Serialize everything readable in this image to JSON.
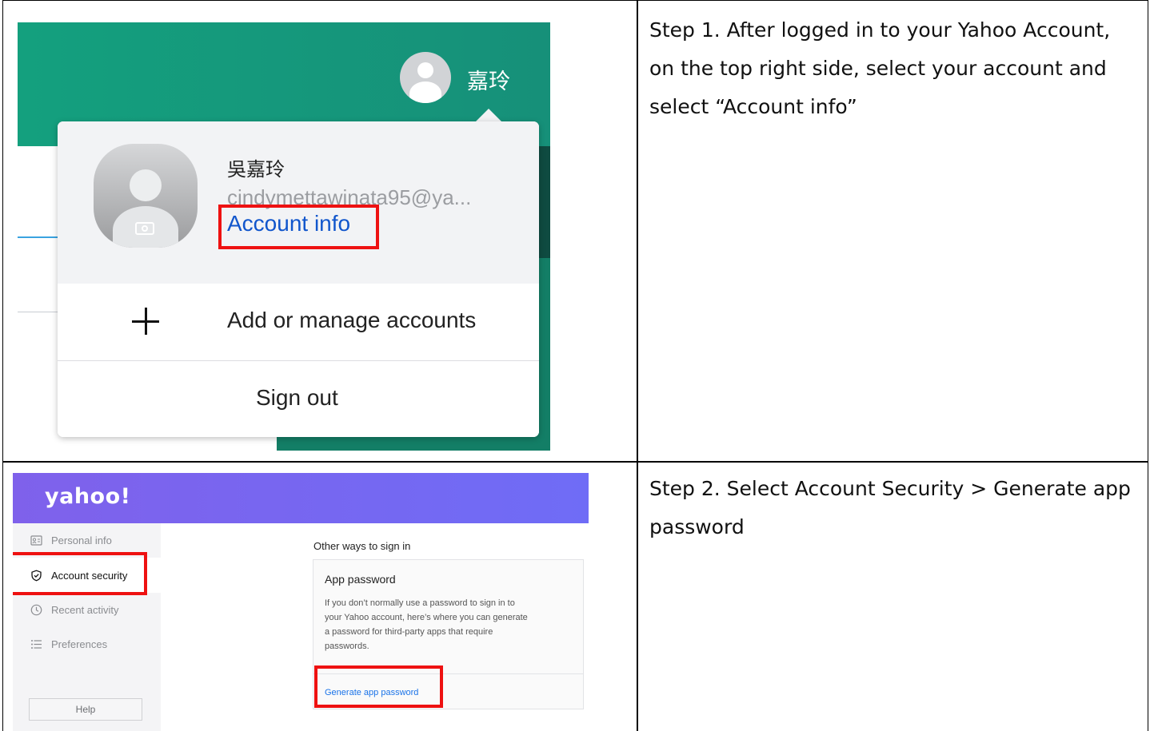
{
  "steps": {
    "step1_text": "Step 1. After logged in to your Yahoo Account, on the top right side, select your account and select “Account info”",
    "step2_text": "Step 2. Select Account Security > Generate app password"
  },
  "screenshot1": {
    "header_name": "嘉玲",
    "menu": {
      "full_name": "吳嘉玲",
      "email": "cindymettawinata95@ya...",
      "account_info_link": "Account info",
      "add_manage_label": "Add or manage accounts",
      "sign_out_label": "Sign out"
    },
    "colors": {
      "header_teal": "#14a07e",
      "highlight_red": "#ee1111",
      "link_blue": "#1156cc"
    }
  },
  "screenshot2": {
    "logo": "yahoo!",
    "sidebar": {
      "items": [
        {
          "label": "Personal info",
          "icon": "id-card-icon"
        },
        {
          "label": "Account security",
          "icon": "shield-icon",
          "selected": true
        },
        {
          "label": "Recent activity",
          "icon": "clock-icon"
        },
        {
          "label": "Preferences",
          "icon": "list-icon"
        }
      ],
      "help_label": "Help"
    },
    "main": {
      "section_title": "Other ways to sign in",
      "card_title": "App password",
      "card_description": "If you don’t normally use a password to sign in to your Yahoo account, here’s where you can generate a password for third-party apps that require passwords.",
      "generate_link": "Generate app password"
    },
    "colors": {
      "header_purple": "#7f61eb",
      "highlight_red": "#ee1111"
    }
  }
}
